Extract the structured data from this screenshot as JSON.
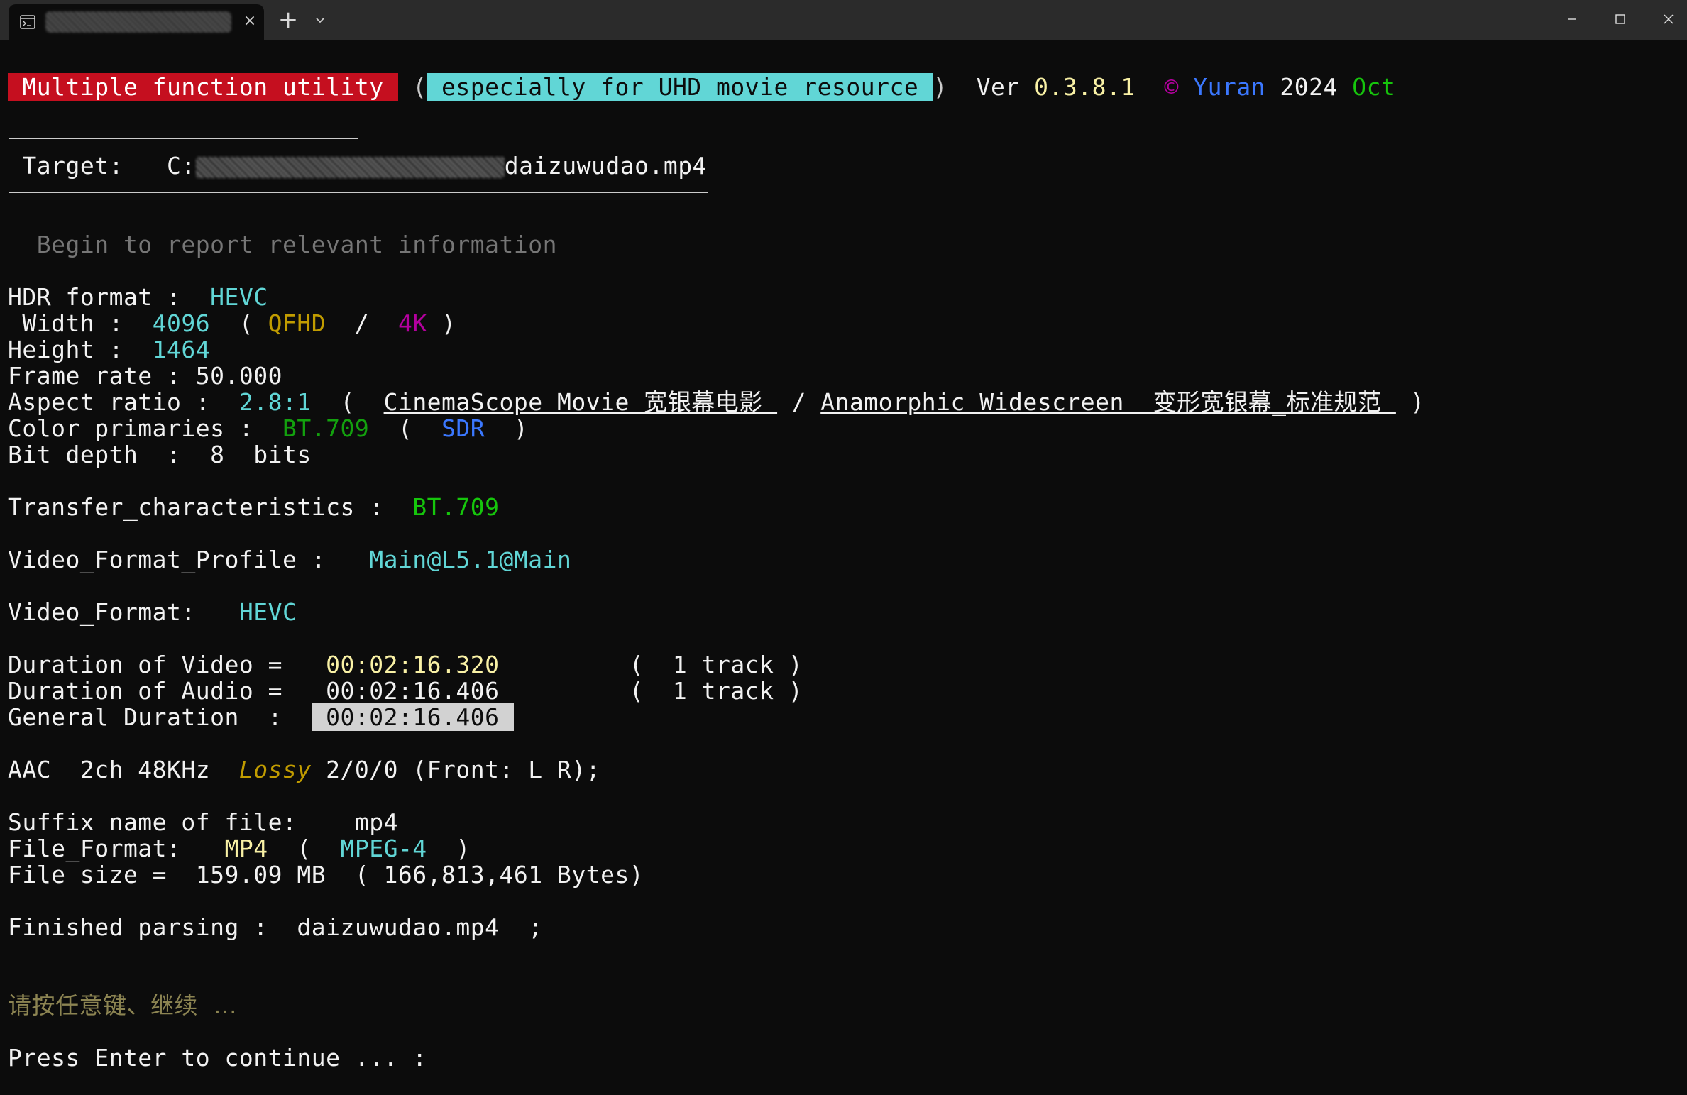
{
  "window": {
    "tab_close": "×",
    "new_tab": "+",
    "colors": {
      "titlebar": "#2b2b2b",
      "background": "#0c0c0c"
    }
  },
  "header": {
    "badge": " Multiple function utility ",
    "paren_open": " (",
    "subtitle": " especially for UHD movie resource ",
    "paren_close": ")",
    "ver_label": "  Ver ",
    "version": "0.3.8.1",
    "copyright": "  © ",
    "author": "Yuran",
    "year": " 2024 ",
    "month": "Oct"
  },
  "target": {
    "label": " Target:   C:",
    "filename": "daizuwudao.mp4"
  },
  "report": {
    "begin": "  Begin to report relevant information",
    "hdr_label": "HDR format :  ",
    "hdr_value": "HEVC",
    "width_label": " Width :  ",
    "width_value": "4096",
    "width_open": "  ( ",
    "width_tag1": "QFHD",
    "width_sep": "  /  ",
    "width_tag2": "4K",
    "width_close": " )",
    "height_label": "Height :  ",
    "height_value": "1464",
    "framerate": "Frame rate : 50.000",
    "aspect_label": "Aspect ratio :  ",
    "aspect_value": "2.8:1",
    "aspect_open": "  (  ",
    "aspect_link1": "CinemaScope Movie 宽银幕电影 ",
    "aspect_sep": " / ",
    "aspect_link2": "Anamorphic Widescreen  变形宽银幕_标准规范 ",
    "aspect_close": " )",
    "primaries_label": "Color primaries :  ",
    "primaries_value": "BT.709",
    "primaries_open": "  (  ",
    "primaries_tag": "SDR",
    "primaries_close": "  )",
    "bitdepth": "Bit depth  :  8  bits",
    "transfer_label": "Transfer_characteristics :  ",
    "transfer_value": "BT.709",
    "profile_label": "Video_Format_Profile :   ",
    "profile_value": "Main@L5.1@Main",
    "format_label": "Video_Format:   ",
    "format_value": "HEVC",
    "dur_video_label": "Duration of Video =   ",
    "dur_video_value": "00:02:16.320",
    "dur_video_tracks": "         (  1 track )",
    "dur_audio_label": "Duration of Audio =   ",
    "dur_audio_value": "00:02:16.406",
    "dur_audio_tracks": "         (  1 track )",
    "dur_general_label": "General Duration  :  ",
    "dur_general_value": " 00:02:16.406 ",
    "audio_prefix": "AAC  2ch 48KHz  ",
    "audio_lossy": "Lossy",
    "audio_suffix": " 2/0/0 (Front: L R);",
    "suffix_label": "Suffix name of file:    ",
    "suffix_value": "mp4",
    "fileformat_label": "File_Format:   ",
    "fileformat_value": "MP4",
    "fileformat_open": "  (  ",
    "fileformat_tag": "MPEG-4",
    "fileformat_close": "  )",
    "filesize": "File size =  159.09 MB  ( 166,813,461 Bytes)",
    "finished_label": "Finished parsing :  ",
    "finished_value": "daizuwudao.mp4",
    "finished_tail": "  ;",
    "press_any_cn": "请按任意键、继续  ...",
    "press_enter": "Press Enter to continue ... :"
  }
}
